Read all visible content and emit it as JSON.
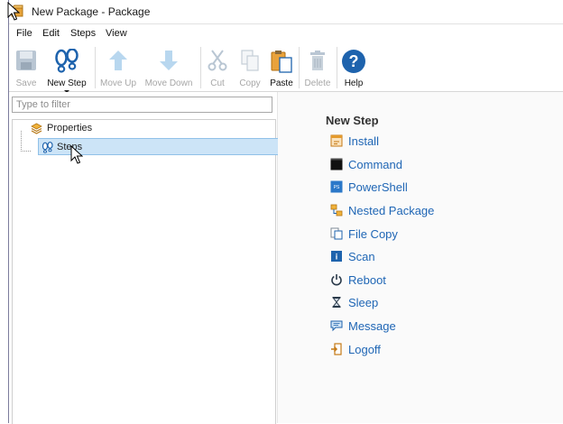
{
  "window": {
    "title": "New Package - Package"
  },
  "menu": {
    "items": [
      "File",
      "Edit",
      "Steps",
      "View"
    ]
  },
  "toolbar": {
    "save_label": "Save",
    "new_step_label": "New Step",
    "move_up_label": "Move Up",
    "move_down_label": "Move Down",
    "cut_label": "Cut",
    "copy_label": "Copy",
    "paste_label": "Paste",
    "delete_label": "Delete",
    "help_label": "Help"
  },
  "filter": {
    "placeholder": "Type to filter"
  },
  "tree": {
    "properties_label": "Properties",
    "steps_label": "Steps"
  },
  "new_step_panel": {
    "title": "New Step",
    "items": [
      {
        "label": "Install",
        "icon": "install-icon"
      },
      {
        "label": "Command",
        "icon": "command-icon"
      },
      {
        "label": "PowerShell",
        "icon": "powershell-icon"
      },
      {
        "label": "Nested Package",
        "icon": "nested-package-icon"
      },
      {
        "label": "File Copy",
        "icon": "file-copy-icon"
      },
      {
        "label": "Scan",
        "icon": "scan-icon"
      },
      {
        "label": "Reboot",
        "icon": "reboot-icon"
      },
      {
        "label": "Sleep",
        "icon": "sleep-icon"
      },
      {
        "label": "Message",
        "icon": "message-icon"
      },
      {
        "label": "Logoff",
        "icon": "logoff-icon"
      }
    ]
  },
  "colors": {
    "accent": "#1f66b5",
    "selection": "#cce4f7",
    "disabled_text": "#a7a7a7"
  }
}
